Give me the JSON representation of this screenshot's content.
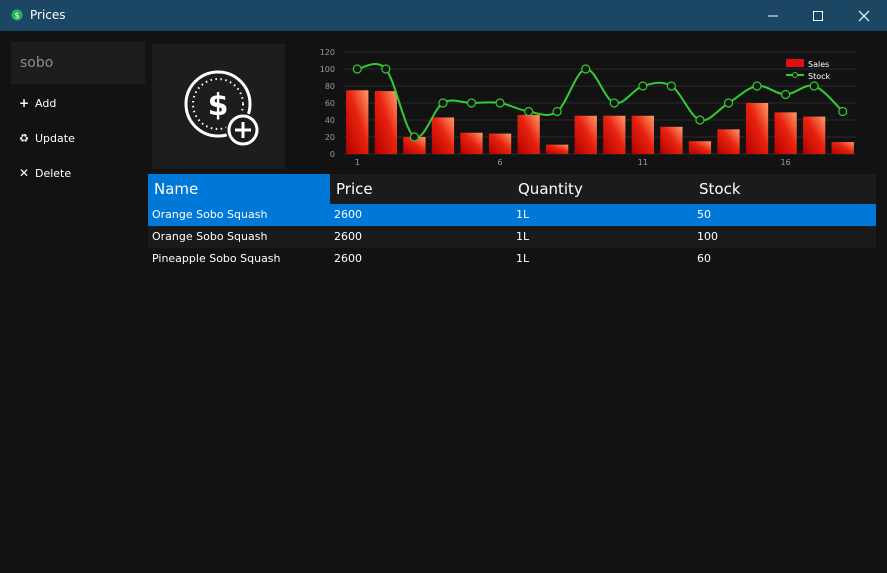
{
  "window": {
    "title": "Prices",
    "icon": "money-icon",
    "controls": [
      "minimize-icon",
      "maximize-icon",
      "close-icon"
    ]
  },
  "search": {
    "value": "sobo"
  },
  "actions": [
    {
      "label": "Add",
      "icon": "plus-icon"
    },
    {
      "label": "Update",
      "icon": "recycle-icon"
    },
    {
      "label": "Delete",
      "icon": "x-icon"
    }
  ],
  "product_image": {
    "icon": "dollar-coin-add-icon"
  },
  "chart_data": {
    "type": "bar",
    "x": [
      1,
      2,
      3,
      4,
      5,
      6,
      7,
      8,
      9,
      10,
      11,
      12,
      13,
      14,
      15,
      16,
      17,
      18
    ],
    "x_tick_labels": [
      "1",
      "6",
      "11",
      "16"
    ],
    "ylim": [
      0,
      120
    ],
    "y_ticks": [
      "0",
      "20",
      "40",
      "60",
      "80",
      "100",
      "120"
    ],
    "grid": true,
    "legend": "top-right",
    "series": [
      {
        "name": "Sales",
        "type": "bar",
        "color": "#e01010",
        "values": [
          75,
          74,
          20,
          43,
          25,
          24,
          46,
          11,
          45,
          45,
          45,
          32,
          15,
          29,
          60,
          49,
          44,
          14
        ]
      },
      {
        "name": "Stock",
        "type": "line",
        "color": "#33cc33",
        "values": [
          100,
          100,
          20,
          60,
          60,
          60,
          50,
          50,
          100,
          60,
          80,
          80,
          40,
          60,
          80,
          70,
          80,
          50
        ]
      }
    ]
  },
  "table": {
    "columns": [
      "Name",
      "Price",
      "Quantity",
      "Stock"
    ],
    "rows": [
      [
        "Orange Sobo Squash",
        "2600",
        "1L",
        "50"
      ],
      [
        "Orange Sobo Squash",
        "2600",
        "1L",
        "100"
      ],
      [
        "Pineapple Sobo Squash",
        "2600",
        "1L",
        "60"
      ]
    ]
  },
  "colors": {
    "titlebar": "#1b4764",
    "background": "#121212",
    "accent": "#0078d7",
    "bar": "#e01010",
    "line": "#33cc33"
  }
}
